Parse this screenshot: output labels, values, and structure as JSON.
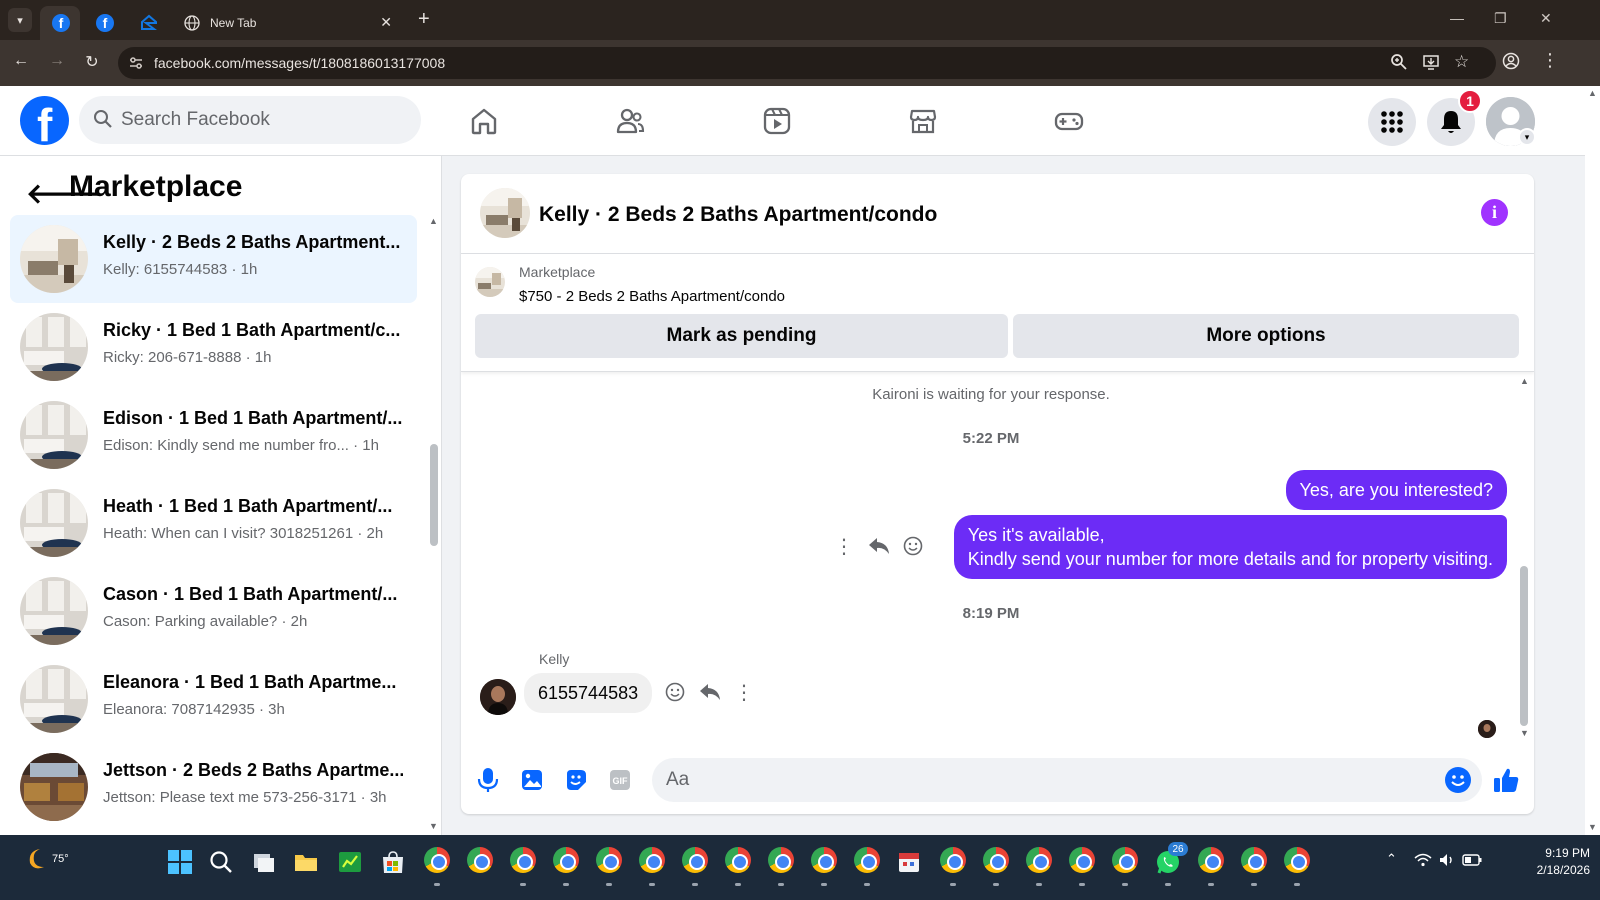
{
  "browser": {
    "tabs": [
      {
        "title": ""
      },
      {
        "title": ""
      },
      {
        "title": ""
      },
      {
        "title": "New Tab"
      }
    ],
    "url": "facebook.com/messages/t/1808186013177008"
  },
  "header": {
    "search_placeholder": "Search Facebook",
    "notifications_count": "1"
  },
  "sidebar": {
    "title": "Marketplace",
    "conversations": [
      {
        "name": "Kelly · 2 Beds 2 Baths Apartment...",
        "preview": "Kelly: 6155744583 · 1h",
        "active": true
      },
      {
        "name": "Ricky · 1 Bed 1 Bath Apartment/c...",
        "preview": "Ricky: 206-671-8888 · 1h"
      },
      {
        "name": "Edison · 1 Bed 1 Bath Apartment/...",
        "preview": "Edison: Kindly send me number fro... · 1h"
      },
      {
        "name": "Heath · 1 Bed 1 Bath Apartment/...",
        "preview": "Heath: When can I visit? 3018251261 · 2h"
      },
      {
        "name": "Cason · 1 Bed 1 Bath Apartment/...",
        "preview": "Cason: Parking available? · 2h"
      },
      {
        "name": "Eleanora · 1 Bed 1 Bath Apartme...",
        "preview": "Eleanora: 7087142935 · 3h"
      },
      {
        "name": "Jettson · 2 Beds 2 Baths Apartme...",
        "preview": "Jettson: Please text me 573-256-3171 · 3h"
      }
    ]
  },
  "chat": {
    "title": "Kelly · 2 Beds 2 Baths Apartment/condo",
    "marketplace_label": "Marketplace",
    "listing": "$750 - 2 Beds 2 Baths Apartment/condo",
    "mark_pending": "Mark as pending",
    "more_options": "More options",
    "system_message": "Kaironi is waiting for your response.",
    "timestamp1": "5:22 PM",
    "out_message1": "Yes, are you interested?",
    "out_message2_line1": "Yes it's available,",
    "out_message2_line2": "Kindly send your number for more details and for property visiting.",
    "timestamp2": "8:19 PM",
    "sender_name": "Kelly",
    "in_message": "6155744583",
    "composer_placeholder": "Aa"
  },
  "taskbar": {
    "temperature": "75°",
    "time": "9:19 PM",
    "date": "2/18/2026",
    "whatsapp_badge": "26"
  },
  "colors": {
    "fb_blue": "#0866ff",
    "outgoing_bubble": "#6c2cf6",
    "info_purple": "#a033ff",
    "notif_red": "#e41e3f"
  }
}
